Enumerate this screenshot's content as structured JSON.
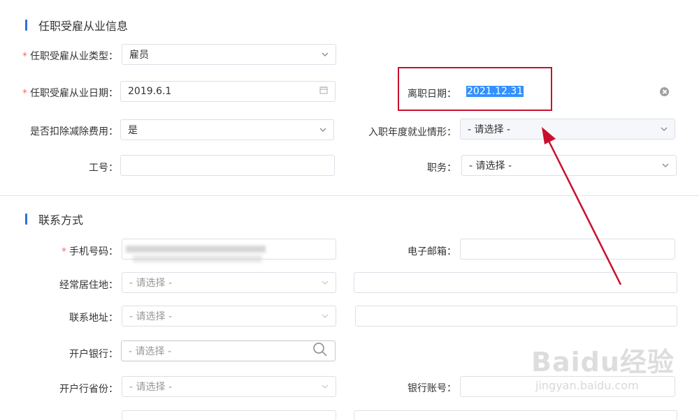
{
  "section1": {
    "title": "任职受雇从业信息",
    "employment_type": {
      "label": "任职受雇从业类型：",
      "value": "雇员"
    },
    "employment_date": {
      "label": "任职受雇从业日期：",
      "value": "2019.6.1"
    },
    "leave_date": {
      "label": "离职日期：",
      "value": "2021.12.31"
    },
    "deduct_fee": {
      "label": "是否扣除减除费用：",
      "value": "是"
    },
    "entry_year_status": {
      "label": "入职年度就业情形：",
      "value": "- 请选择 -"
    },
    "employee_no": {
      "label": "工号：",
      "value": ""
    },
    "position": {
      "label": "职务：",
      "value": "- 请选择 -"
    }
  },
  "section2": {
    "title": "联系方式",
    "mobile": {
      "label": "手机号码：",
      "value": ""
    },
    "email": {
      "label": "电子邮箱：",
      "value": ""
    },
    "residence": {
      "label": "经常居住地：",
      "placeholder": "- 请选择 -"
    },
    "address": {
      "label": "联系地址：",
      "placeholder": "- 请选择 -"
    },
    "bank": {
      "label": "开户银行：",
      "placeholder": "- 请选择 -"
    },
    "bank_province": {
      "label": "开户行省份：",
      "placeholder": "- 请选择 -"
    },
    "bank_account": {
      "label": "银行账号：",
      "value": ""
    }
  },
  "watermark": {
    "brand": "Baidu经验",
    "url": "jingyan.baidu.com"
  },
  "colors": {
    "accent": "#2f6fe0",
    "annotation": "#c8102e",
    "required": "#f56c6c",
    "selection": "#3390ff"
  }
}
